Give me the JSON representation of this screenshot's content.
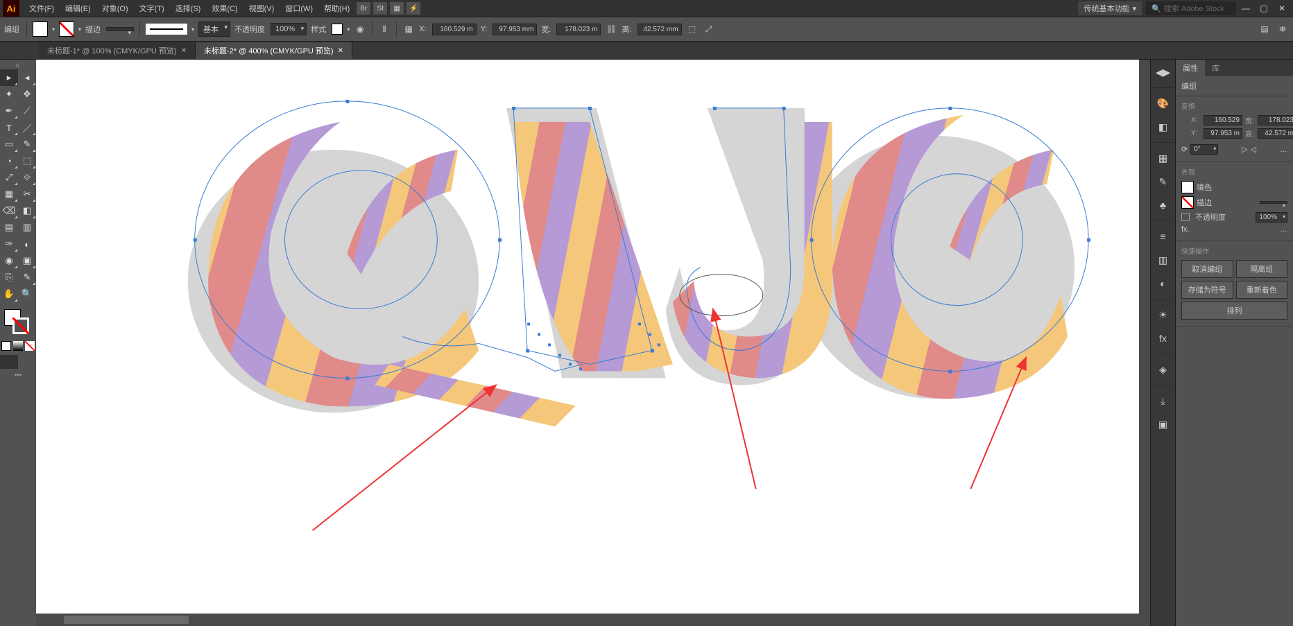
{
  "app": {
    "logo": "Ai"
  },
  "menu": {
    "items": [
      "文件(F)",
      "编辑(E)",
      "对象(O)",
      "文字(T)",
      "选择(S)",
      "效果(C)",
      "视图(V)",
      "窗口(W)",
      "帮助(H)"
    ]
  },
  "workspace": {
    "label": "传统基本功能",
    "search_placeholder": "搜索 Adobe Stock"
  },
  "control": {
    "selection_label": "编组",
    "stroke_label": "描边",
    "stroke_weight": "",
    "brush_label": "基本",
    "opacity_label": "不透明度",
    "opacity_value": "100%",
    "style_label": "样式",
    "x_label": "X:",
    "x_value": "160.529 m",
    "y_label": "Y:",
    "y_value": "97.953 mm",
    "w_label": "宽:",
    "w_value": "178.023 m",
    "h_label": "高:",
    "h_value": "42.572 mm"
  },
  "tabs": [
    {
      "label": "未标题-1* @ 100% (CMYK/GPU 预览)",
      "active": false
    },
    {
      "label": "未标题-2* @ 400% (CMYK/GPU 预览)",
      "active": true
    }
  ],
  "properties": {
    "tab1": "属性",
    "tab2": "库",
    "object_type": "编组",
    "transform_title": "变换",
    "x_label": "X:",
    "x_value": "160.529",
    "y_label": "Y:",
    "y_value": "97.953 m",
    "w_label": "宽:",
    "w_value": "178.023",
    "h_label": "高:",
    "h_value": "42.572 m",
    "angle_label": "⟳",
    "angle_value": "0°",
    "flip_label": "▷◁",
    "more1": "…",
    "appearance_title": "外观",
    "fill_label": "填色",
    "stroke_label": "描边",
    "stroke_weight_value": "",
    "opacity_label": "不透明度",
    "opacity_value": "100%",
    "fx_label": "fx.",
    "more2": "…",
    "quick_title": "快速操作",
    "btn_ungroup": "取消编组",
    "btn_isolate": "隔离组",
    "btn_save_symbol": "存储为符号",
    "btn_recolor": "重新着色",
    "btn_arrange": "排列"
  },
  "tool_glyphs": [
    [
      "▸",
      "◂"
    ],
    [
      "✦",
      "✥"
    ],
    [
      "✒",
      "⟋"
    ],
    [
      "T",
      "／"
    ],
    [
      "▭",
      "✎"
    ],
    [
      "◔",
      "⬚"
    ],
    [
      "⤢",
      "⟐"
    ],
    [
      "▦",
      "✂"
    ],
    [
      "⌫",
      "◧"
    ],
    [
      "▤",
      "▥"
    ],
    [
      "✑",
      "◐"
    ],
    [
      "◉",
      "▣"
    ],
    [
      "⎘",
      "✎"
    ],
    [
      "✋",
      "🔍"
    ]
  ],
  "dock_icons": [
    "⊞",
    "▦",
    "A",
    "◆",
    "≡",
    "◧",
    "≣",
    "☀",
    "⧉",
    "◨",
    "⧈",
    "⎙"
  ]
}
